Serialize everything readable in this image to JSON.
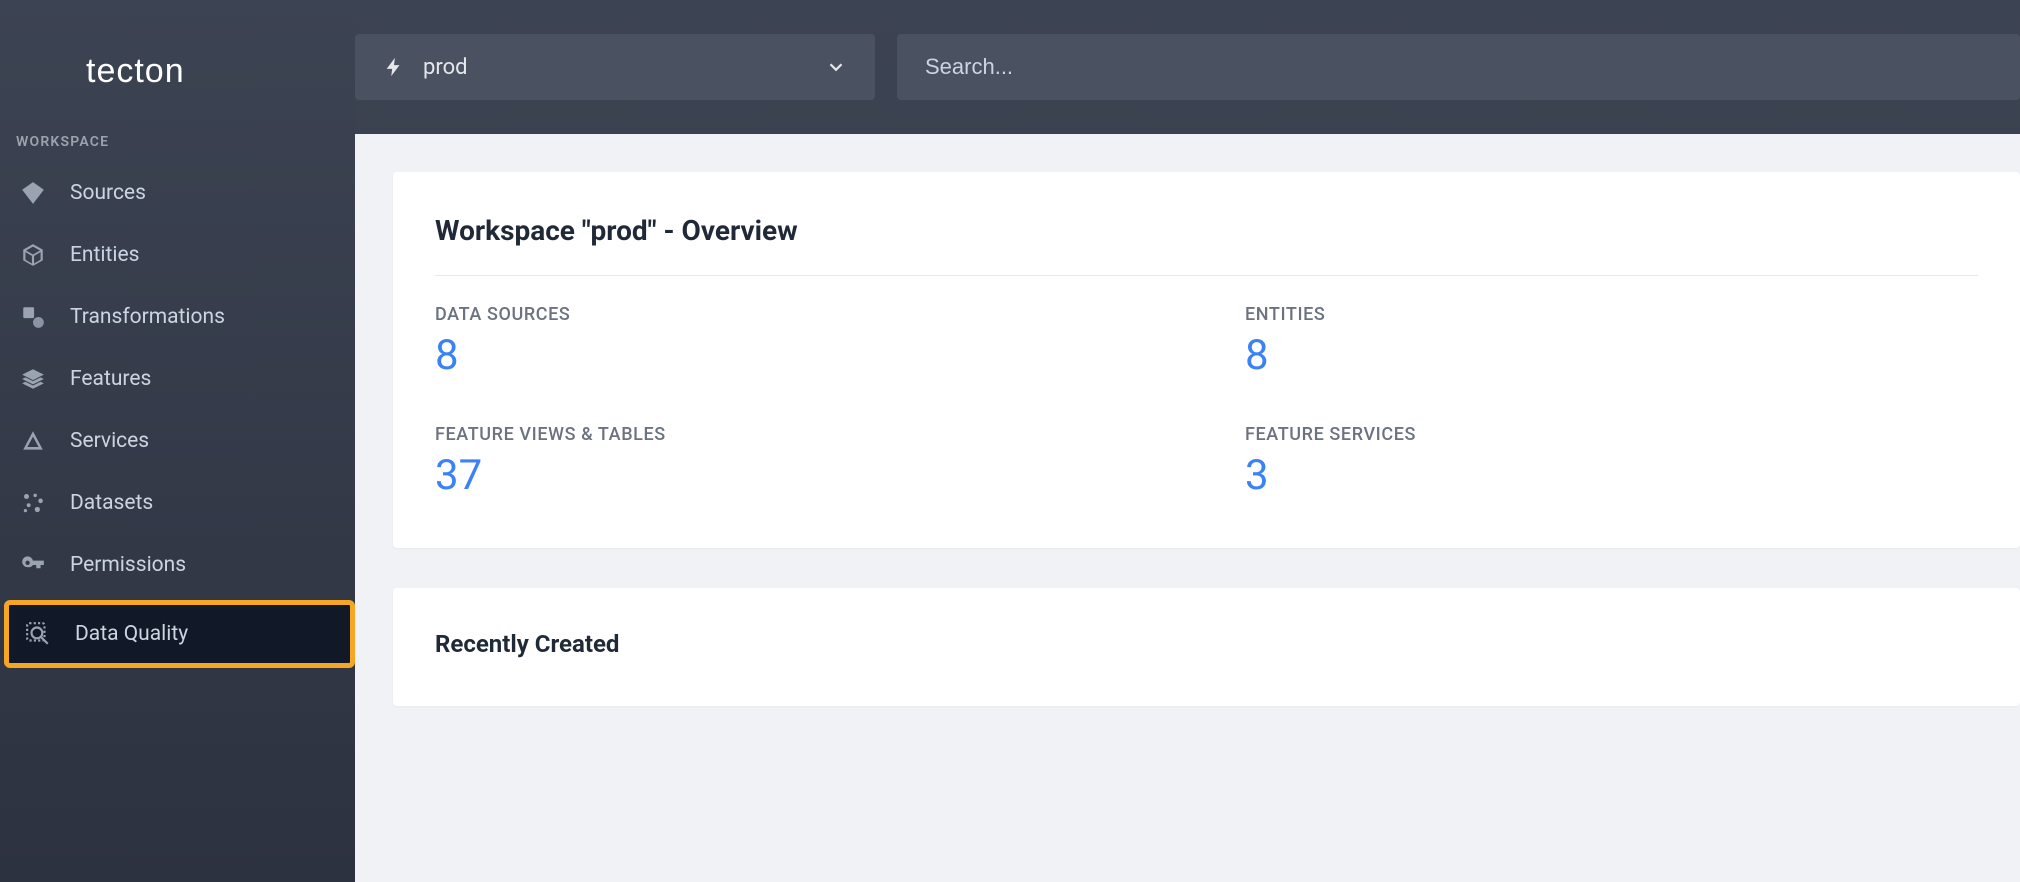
{
  "brand": "tecton",
  "sidebar": {
    "section_label": "WORKSPACE",
    "items": [
      {
        "label": "Sources",
        "icon": "diamond"
      },
      {
        "label": "Entities",
        "icon": "cube"
      },
      {
        "label": "Transformations",
        "icon": "shapes"
      },
      {
        "label": "Features",
        "icon": "layers"
      },
      {
        "label": "Services",
        "icon": "pyramid"
      },
      {
        "label": "Datasets",
        "icon": "dots"
      },
      {
        "label": "Permissions",
        "icon": "key"
      },
      {
        "label": "Data Quality",
        "icon": "magnifier-grid",
        "highlighted": true
      }
    ]
  },
  "topbar": {
    "workspace_selector": {
      "selected": "prod"
    },
    "search": {
      "placeholder": "Search..."
    }
  },
  "overview": {
    "title": "Workspace \"prod\" - Overview",
    "stats": [
      {
        "key": "DATA SOURCES",
        "value": "8"
      },
      {
        "key": "ENTITIES",
        "value": "8"
      },
      {
        "key": "FEATURE VIEWS & TABLES",
        "value": "37"
      },
      {
        "key": "FEATURE SERVICES",
        "value": "3"
      }
    ]
  },
  "recent": {
    "title": "Recently Created"
  }
}
